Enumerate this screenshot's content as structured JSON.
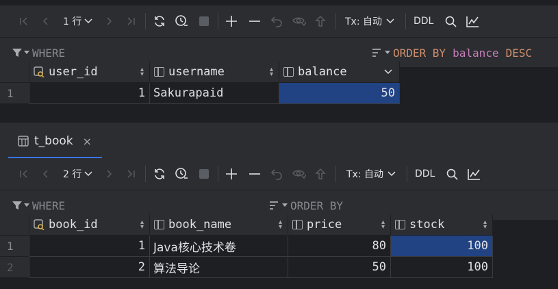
{
  "toolbar1": {
    "rows_label": "1 行",
    "tx_label": "Tx: 自动",
    "ddl_label": "DDL"
  },
  "filter1": {
    "where_label": "WHERE",
    "order_kw": "ORDER BY",
    "order_col": "balance",
    "order_dir": "DESC"
  },
  "grid1": {
    "columns": [
      "user_id",
      "username",
      "balance"
    ],
    "rows": [
      {
        "n": "1",
        "user_id": "1",
        "username": "Sakurapaid",
        "balance": "50"
      }
    ]
  },
  "tab": {
    "label": "t_book",
    "close": "×"
  },
  "toolbar2": {
    "rows_label": "2 行",
    "tx_label": "Tx: 自动",
    "ddl_label": "DDL"
  },
  "filter2": {
    "where_label": "WHERE",
    "order_kw": "ORDER BY"
  },
  "grid2": {
    "columns": [
      "book_id",
      "book_name",
      "price",
      "stock"
    ],
    "rows": [
      {
        "n": "1",
        "book_id": "1",
        "book_name": "Java核心技术卷",
        "price": "80",
        "stock": "100"
      },
      {
        "n": "2",
        "book_id": "2",
        "book_name": "算法导论",
        "price": "50",
        "stock": "100"
      }
    ]
  },
  "colors": {
    "selection": "#214283",
    "accent": "#3574f0",
    "keyword": "#cf8e6d",
    "identifier": "#c77dbb"
  }
}
